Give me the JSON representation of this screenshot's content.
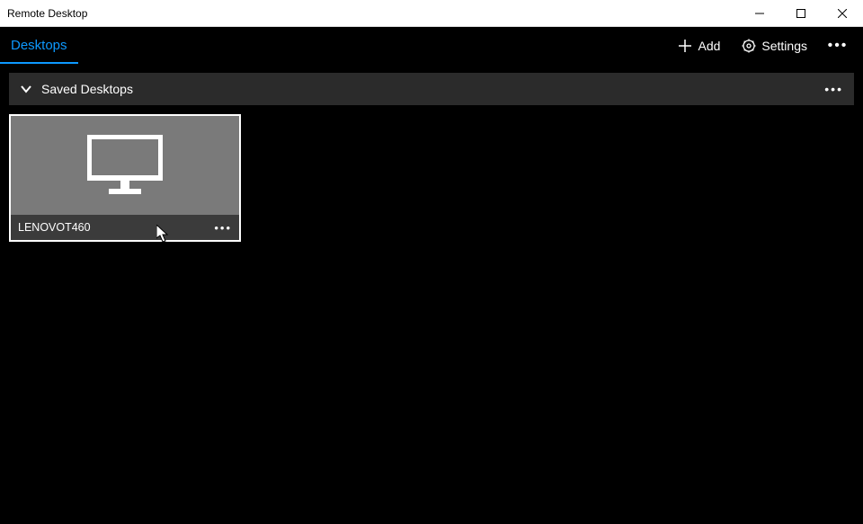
{
  "window": {
    "title": "Remote Desktop"
  },
  "appbar": {
    "tab_desktops": "Desktops",
    "add_label": "Add",
    "settings_label": "Settings"
  },
  "section": {
    "title": "Saved Desktops"
  },
  "tiles": [
    {
      "name": "LENOVOT460"
    }
  ]
}
